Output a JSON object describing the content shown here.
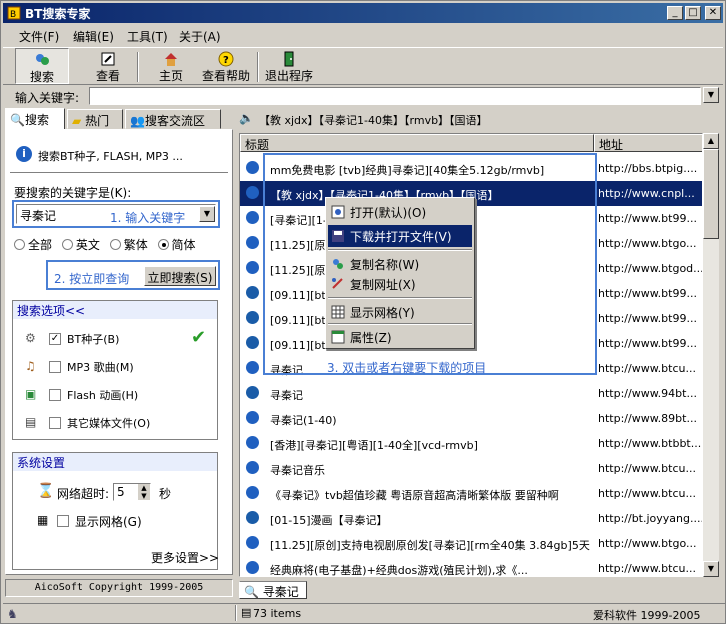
{
  "window": {
    "title": "BT搜索专家"
  },
  "menu": [
    "文件(F)",
    "编辑(E)",
    "工具(T)",
    "关于(A)"
  ],
  "toolbar": {
    "search": "搜索",
    "view": "查看",
    "home": "主页",
    "help": "查看帮助",
    "exit": "退出程序"
  },
  "keyword_bar": {
    "label": "输入关键字:",
    "value": ""
  },
  "left_tabs": [
    "搜索",
    "热门",
    "搜客交流区"
  ],
  "left": {
    "header": "搜索BT种子, FLASH, MP3 ...",
    "keyword_label": "要搜索的关键字是(K):",
    "keyword_value": "寻秦记",
    "anno1": "1. 输入关键字",
    "radios": [
      "全部",
      "英文",
      "繁体",
      "简体"
    ],
    "anno2": "2. 按立即查询",
    "search_now": "立即搜索(S)",
    "options_title": "搜索选项<<",
    "options": [
      "BT种子(B)",
      "MP3 歌曲(M)",
      "Flash 动画(H)",
      "其它媒体文件(O)"
    ],
    "settings_title": "系统设置",
    "timeout_label": "网络超时:",
    "timeout_value": "5",
    "timeout_unit": "秒",
    "grid_label": "显示网格(G)",
    "more": "更多设置>>",
    "copyright": "AicoSoft Copyright 1999-2005"
  },
  "right": {
    "path": "【教 xjdx】【寻秦记1-40集】【rmvb】【国语】",
    "col_title": "标题",
    "col_url": "地址",
    "rows": [
      {
        "t": "mm免费电影 [tvb]经典]寻秦记][40集全5.12gb/rmvb]",
        "u": "http://bbs.btpig...."
      },
      {
        "t": "【教 xjdx】【寻秦记1-40集】【rmvb】【国语】",
        "u": "http://www.cnpl..."
      },
      {
        "t": "[寻秦记][1-40集",
        "u": "http://www.bt99..."
      },
      {
        "t": "[11.25][原创]",
        "u": "http://www.btgo..."
      },
      {
        "t": "[11.25][原创]",
        "u": "http://www.btgod..."
      },
      {
        "t": "[09.11][btp] 子真帅[原版dvd-rmv...",
        "u": "http://www.bt99..."
      },
      {
        "t": "[09.11][btp] 子真帅[原版dvd-rmv...",
        "u": "http://www.bt99..."
      },
      {
        "t": "[09.11][btp] 子真帅[原版dvd-rmv...",
        "u": "http://www.bt99..."
      },
      {
        "t": "寻秦记",
        "u": "http://www.btcu..."
      },
      {
        "t": "寻秦记",
        "u": "http://www.94bt..."
      },
      {
        "t": "寻秦记(1-40)",
        "u": "http://www.89bt..."
      },
      {
        "t": "[香港][寻秦记][粤语][1-40全][vcd-rmvb]",
        "u": "http://www.btbbt..."
      },
      {
        "t": "寻秦记音乐",
        "u": "http://www.btcu..."
      },
      {
        "t": "《寻秦记》tvb超值珍藏 粤语原音超高清晰繁体版 要留种啊",
        "u": "http://www.btcu..."
      },
      {
        "t": "[01-15]漫画【寻秦记】",
        "u": "http://bt.joyyang...."
      },
      {
        "t": "[11.25][原创]支持电视剧原创发[寻秦记][rm全40集 3.84gb]5天",
        "u": "http://www.btgo..."
      },
      {
        "t": "经典麻将(电子基盘)+经典dos游戏(殖民计划),求《...",
        "u": "http://www.btcu..."
      }
    ],
    "anno3": "3. 双击或者右键要下载的项目",
    "bottom_tab": "寻秦记"
  },
  "context_menu": [
    "打开(默认)(O)",
    "下载并打开文件(V)",
    "复制名称(W)",
    "复制网址(X)",
    "显示网格(Y)",
    "属性(Z)"
  ],
  "status": {
    "items": "73 items",
    "right": "爱科软件 1999-2005"
  }
}
